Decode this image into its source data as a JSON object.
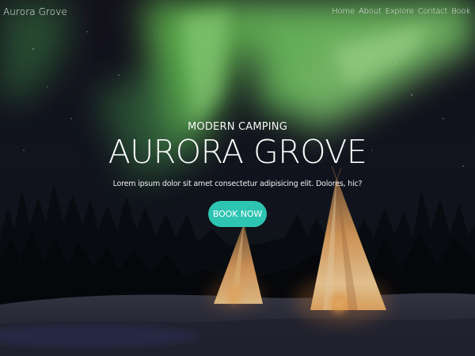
{
  "brand": {
    "name": "Aurora Grove"
  },
  "nav": {
    "items": [
      {
        "label": "Home"
      },
      {
        "label": "About"
      },
      {
        "label": "Explore"
      },
      {
        "label": "Contact"
      },
      {
        "label": "Book"
      }
    ]
  },
  "hero": {
    "eyebrow": "MODERN CAMPING",
    "title": "AURORA GROVE",
    "tagline": "Lorem ipsum dolor sit amet consectetur adipisicing elit. Dolores, hic?",
    "cta_label": "BOOK NOW"
  },
  "colors": {
    "accent": "#2ec4b2",
    "aurora": "#7fd46a"
  }
}
